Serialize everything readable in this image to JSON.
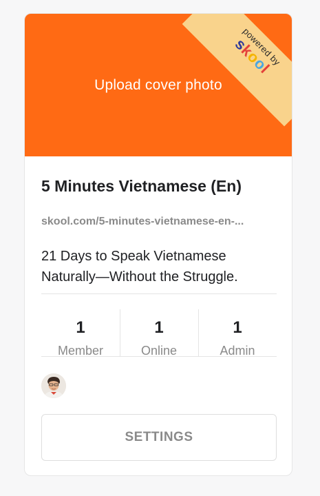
{
  "cover": {
    "upload_label": "Upload cover photo",
    "background_color": "#ff6a14"
  },
  "badge": {
    "powered_by": "powered by",
    "brand": "skool",
    "brand_letters": [
      "s",
      "k",
      "o",
      "o",
      "l"
    ],
    "ribbon_color": "#f9d38c"
  },
  "group": {
    "title": "5 Minutes Vietnamese (En)",
    "url": "skool.com/5-minutes-vietnamese-en-...",
    "description": "21 Days to Speak Vietnamese Naturally—Without the Struggle."
  },
  "stats": [
    {
      "value": "1",
      "label": "Member"
    },
    {
      "value": "1",
      "label": "Online"
    },
    {
      "value": "1",
      "label": "Admin"
    }
  ],
  "members": {
    "avatar_icon": "user-avatar"
  },
  "actions": {
    "settings_label": "SETTINGS"
  }
}
